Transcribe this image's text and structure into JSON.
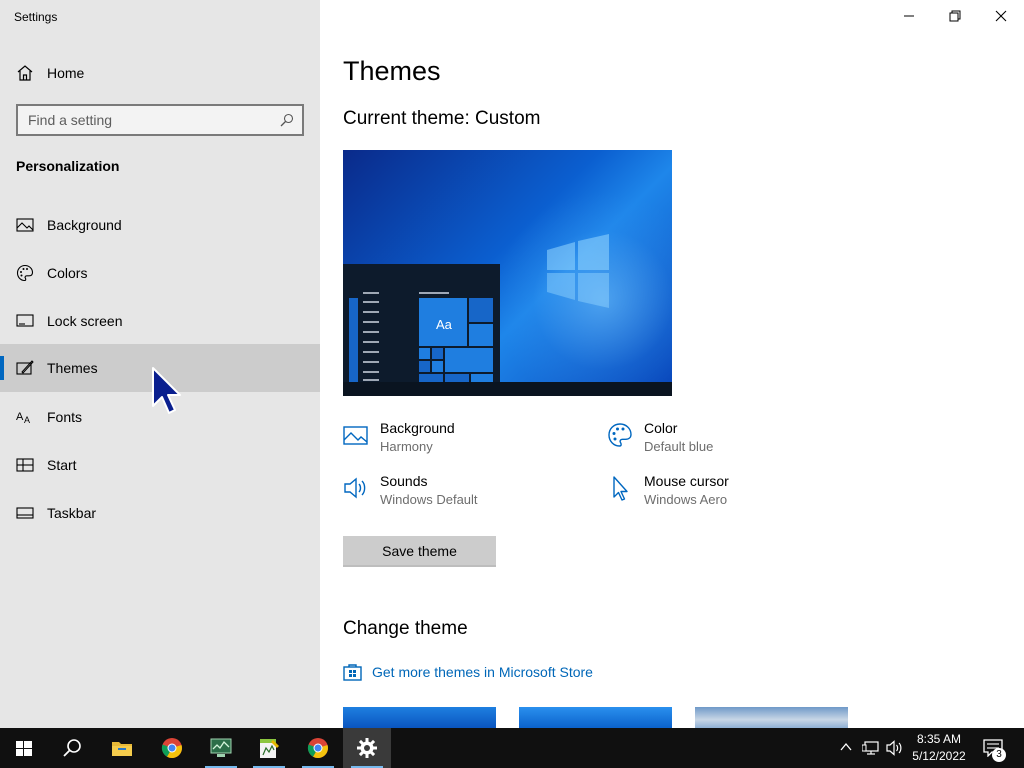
{
  "window": {
    "title": "Settings"
  },
  "sidebar": {
    "home_label": "Home",
    "search_placeholder": "Find a setting",
    "section": "Personalization",
    "items": [
      {
        "label": "Background",
        "icon": "picture-icon"
      },
      {
        "label": "Colors",
        "icon": "palette-icon"
      },
      {
        "label": "Lock screen",
        "icon": "lock-screen-icon"
      },
      {
        "label": "Themes",
        "icon": "themes-icon",
        "selected": true
      },
      {
        "label": "Fonts",
        "icon": "fonts-icon"
      },
      {
        "label": "Start",
        "icon": "start-icon"
      },
      {
        "label": "Taskbar",
        "icon": "taskbar-icon"
      }
    ]
  },
  "main": {
    "title": "Themes",
    "current_theme": "Current theme: Custom",
    "preview_sample_text": "Aa",
    "properties": [
      {
        "title": "Background",
        "value": "Harmony",
        "icon": "picture-icon"
      },
      {
        "title": "Color",
        "value": "Default blue",
        "icon": "palette-icon"
      },
      {
        "title": "Sounds",
        "value": "Windows Default",
        "icon": "speaker-icon"
      },
      {
        "title": "Mouse cursor",
        "value": "Windows Aero",
        "icon": "cursor-icon"
      }
    ],
    "save_button": "Save theme",
    "change_theme_heading": "Change theme",
    "store_link": "Get more themes in Microsoft Store"
  },
  "taskbar": {
    "time": "8:35 AM",
    "date": "5/12/2022",
    "notification_count": "3",
    "accent": "#76b9ed"
  },
  "colors": {
    "accent": "#0067c0",
    "link": "#0067b8",
    "sidebar_bg": "#e6e6e6"
  }
}
